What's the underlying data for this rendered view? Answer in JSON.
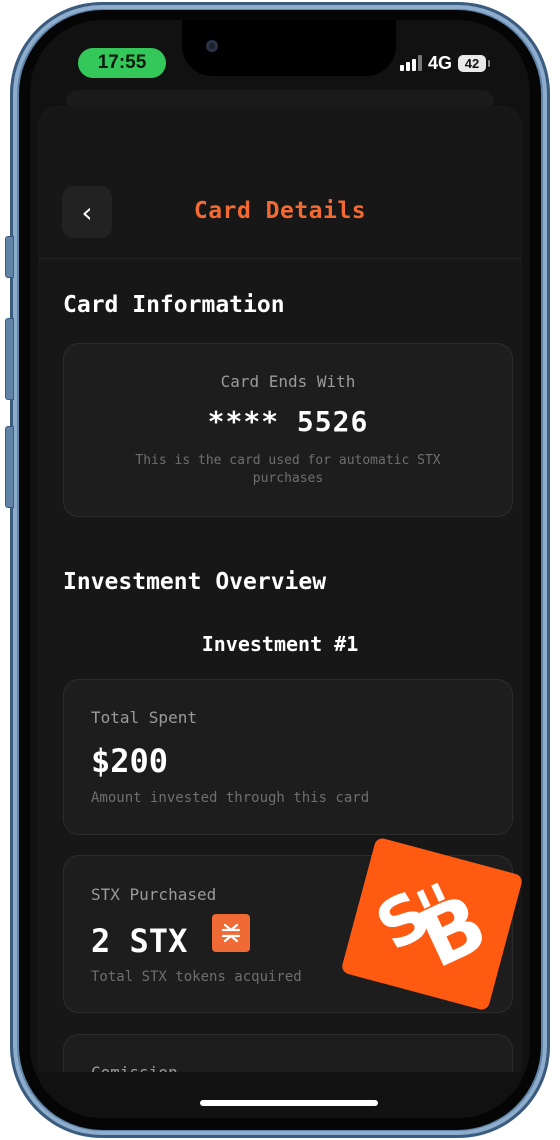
{
  "status_bar": {
    "time": "17:55",
    "network": "4G",
    "battery": "42"
  },
  "header": {
    "back_label": "‹",
    "title": "Card Details"
  },
  "card_info": {
    "section_title": "Card Information",
    "label": "Card Ends With",
    "number": "**** 5526",
    "description": "This is the card used for automatic STX purchases"
  },
  "investment": {
    "section_title": "Investment Overview",
    "subtitle": "Investment #1",
    "total_spent": {
      "label": "Total Spent",
      "value": "$200",
      "description": "Amount invested through this card"
    },
    "stx_purchased": {
      "label": "STX Purchased",
      "value": "2 STX",
      "badge_icon": "⁎",
      "description": "Total STX tokens acquired"
    },
    "commission": {
      "label": "Comission"
    }
  },
  "colors": {
    "accent": "#f26a31",
    "logo": "#fe5a12",
    "status_pill": "#34c759"
  }
}
